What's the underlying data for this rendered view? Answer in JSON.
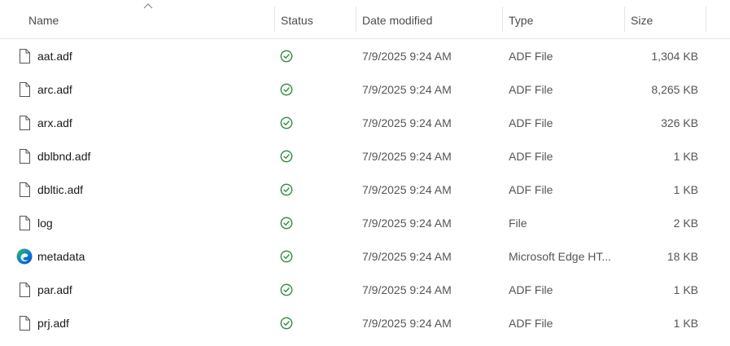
{
  "columns": {
    "name": "Name",
    "status": "Status",
    "date_modified": "Date modified",
    "type": "Type",
    "size": "Size"
  },
  "colors": {
    "status_ok": "#2e8b3f",
    "header_text": "#4c4c4c",
    "edge_blue": "#0f7ad8",
    "edge_green": "#35c04a"
  },
  "files": [
    {
      "name": "aat.adf",
      "icon": "file-icon",
      "status": "synced-check-icon",
      "date": "7/9/2025 9:24 AM",
      "type": "ADF File",
      "size": "1,304 KB"
    },
    {
      "name": "arc.adf",
      "icon": "file-icon",
      "status": "synced-check-icon",
      "date": "7/9/2025 9:24 AM",
      "type": "ADF File",
      "size": "8,265 KB"
    },
    {
      "name": "arx.adf",
      "icon": "file-icon",
      "status": "synced-check-icon",
      "date": "7/9/2025 9:24 AM",
      "type": "ADF File",
      "size": "326 KB"
    },
    {
      "name": "dblbnd.adf",
      "icon": "file-icon",
      "status": "synced-check-icon",
      "date": "7/9/2025 9:24 AM",
      "type": "ADF File",
      "size": "1 KB"
    },
    {
      "name": "dbltic.adf",
      "icon": "file-icon",
      "status": "synced-check-icon",
      "date": "7/9/2025 9:24 AM",
      "type": "ADF File",
      "size": "1 KB"
    },
    {
      "name": "log",
      "icon": "file-icon",
      "status": "synced-check-icon",
      "date": "7/9/2025 9:24 AM",
      "type": "File",
      "size": "2 KB"
    },
    {
      "name": "metadata",
      "icon": "edge-browser-icon",
      "status": "synced-check-icon",
      "date": "7/9/2025 9:24 AM",
      "type": "Microsoft Edge HT...",
      "size": "18 KB"
    },
    {
      "name": "par.adf",
      "icon": "file-icon",
      "status": "synced-check-icon",
      "date": "7/9/2025 9:24 AM",
      "type": "ADF File",
      "size": "1 KB"
    },
    {
      "name": "prj.adf",
      "icon": "file-icon",
      "status": "synced-check-icon",
      "date": "7/9/2025 9:24 AM",
      "type": "ADF File",
      "size": "1 KB"
    }
  ]
}
